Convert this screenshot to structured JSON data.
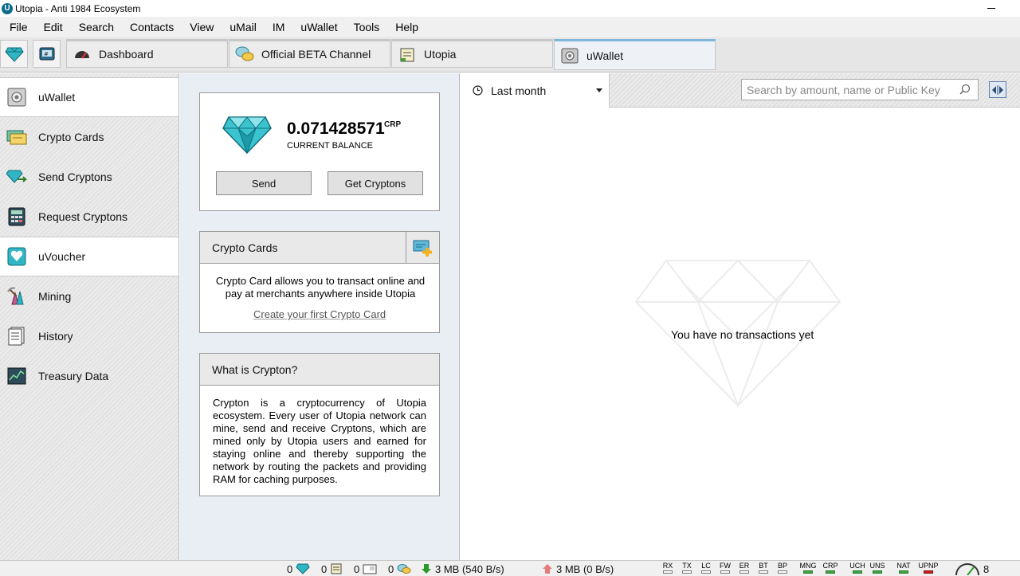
{
  "window": {
    "title": "Utopia - Anti 1984 Ecosystem"
  },
  "menu": [
    "File",
    "Edit",
    "Search",
    "Contacts",
    "View",
    "uMail",
    "IM",
    "uWallet",
    "Tools",
    "Help"
  ],
  "tabs": [
    {
      "label": "Dashboard",
      "icon": "speedometer-icon"
    },
    {
      "label": "Official BETA Channel",
      "icon": "chat-bubbles-icon"
    },
    {
      "label": "Utopia",
      "icon": "notebook-icon"
    },
    {
      "label": "uWallet",
      "icon": "wallet-icon",
      "active": true
    }
  ],
  "sidebar": {
    "items": [
      {
        "label": "uWallet",
        "icon": "wallet-icon"
      },
      {
        "label": "Crypto Cards",
        "icon": "crypto-card-icon"
      },
      {
        "label": "Send Cryptons",
        "icon": "send-crystal-icon"
      },
      {
        "label": "Request Cryptons",
        "icon": "calculator-icon"
      },
      {
        "label": "uVoucher",
        "icon": "voucher-icon"
      },
      {
        "label": "Mining",
        "icon": "mining-icon"
      },
      {
        "label": "History",
        "icon": "history-icon"
      },
      {
        "label": "Treasury Data",
        "icon": "treasury-chart-icon"
      }
    ]
  },
  "balance": {
    "value": "0.071428571",
    "unit": "CRP",
    "label": "CURRENT BALANCE",
    "send_label": "Send",
    "get_label": "Get Cryptons"
  },
  "crypto_cards": {
    "title": "Crypto Cards",
    "text": "Crypto Card allows you to transact online and pay at merchants anywhere inside Utopia",
    "link": "Create your first Crypto Card"
  },
  "what_is": {
    "title": "What is Crypton?",
    "text": "Crypton is a cryptocurrency of Utopia ecosystem. Every user of Utopia network can mine, send and receive Cryptons, which are mined only by Utopia users and earned for staying online and thereby supporting the network by routing the packets and providing RAM for caching purposes."
  },
  "transactions": {
    "period": "Last month",
    "search_placeholder": "Search by amount, name or Public Key",
    "empty": "You have no transactions yet"
  },
  "statusbar": {
    "counts": [
      "0",
      "0",
      "0",
      "0"
    ],
    "download": "3 MB (540 B/s)",
    "upload": "3 MB (0 B/s)",
    "indicators": [
      "RX",
      "TX",
      "LC",
      "FW",
      "ER",
      "BT",
      "BP",
      "MNG",
      "CRP",
      "UCH",
      "UNS",
      "NAT",
      "UPNP"
    ],
    "connections": "8"
  },
  "colors": {
    "accent": "#7fb6dc",
    "crystal": "#2fb5c4",
    "ok": "#3aa640",
    "error": "#c42020"
  }
}
